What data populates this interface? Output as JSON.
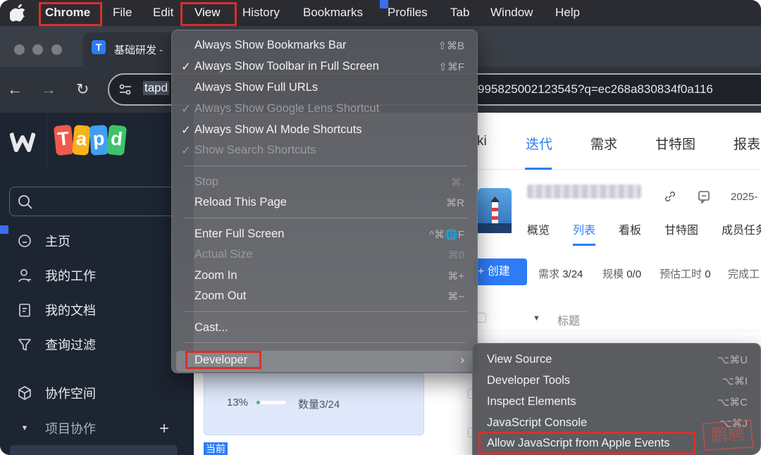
{
  "menubar": {
    "items": [
      "Chrome",
      "View",
      "Edit",
      "History",
      "Bookmarks",
      "Profiles",
      "Tab",
      "Window",
      "Help"
    ],
    "chrome": "Chrome",
    "file": "File",
    "edit": "Edit",
    "view": "View",
    "history": "History",
    "bookmarks": "Bookmarks",
    "profiles": "Profiles",
    "tab": "Tab",
    "window": "Window",
    "help": "Help"
  },
  "browser": {
    "tab_title": "基础研发 -",
    "url_selected": "tapd",
    "url_tail": "995825002123545?q=ec268a830834f0a116"
  },
  "sidebar": {
    "search_placeholder": "",
    "items": {
      "home": "主页",
      "my_work": "我的工作",
      "my_docs": "我的文档",
      "query_filter": "查询过滤",
      "collab_space": "协作空间",
      "project_collab": "项目协作"
    }
  },
  "main": {
    "topnav": {
      "wiki": "ki",
      "iteration": "迭代",
      "requirement": "需求",
      "gantt": "甘特图",
      "report": "报表"
    },
    "date": "2025-",
    "subnav": {
      "overview": "概览",
      "list": "列表",
      "board": "看板",
      "gantt": "甘特图",
      "members": "成员任务"
    },
    "create_button": "+ 创建",
    "stats": {
      "req_label": "需求",
      "req_value": "3/24",
      "scale_label": "规模",
      "scale_value": "0/0",
      "est_label": "预估工时",
      "est_value": "0",
      "done_label": "完成工"
    },
    "column_title": "标题",
    "card": {
      "percent": "13%",
      "progress": 0.13,
      "count": "数量3/24"
    },
    "current_tag": "当前"
  },
  "view_menu": {
    "items": [
      {
        "label": "Always Show Bookmarks Bar",
        "shortcut": "⇧⌘B",
        "checked": false,
        "disabled": false
      },
      {
        "label": "Always Show Toolbar in Full Screen",
        "shortcut": "⇧⌘F",
        "checked": true,
        "disabled": false
      },
      {
        "label": "Always Show Full URLs",
        "shortcut": "",
        "checked": false,
        "disabled": false
      },
      {
        "label": "Always Show Google Lens Shortcut",
        "shortcut": "",
        "checked": true,
        "disabled": true
      },
      {
        "label": "Always Show AI Mode Shortcuts",
        "shortcut": "",
        "checked": true,
        "disabled": false
      },
      {
        "label": "Show Search Shortcuts",
        "shortcut": "",
        "checked": true,
        "disabled": true
      },
      {
        "label": "Stop",
        "shortcut": "⌘.",
        "checked": false,
        "disabled": true
      },
      {
        "label": "Reload This Page",
        "shortcut": "⌘R",
        "checked": false,
        "disabled": false
      },
      {
        "label": "Enter Full Screen",
        "shortcut": "^⌘🌐F",
        "checked": false,
        "disabled": false
      },
      {
        "label": "Actual Size",
        "shortcut": "⌘0",
        "checked": false,
        "disabled": true
      },
      {
        "label": "Zoom In",
        "shortcut": "⌘+",
        "checked": false,
        "disabled": false
      },
      {
        "label": "Zoom Out",
        "shortcut": "⌘−",
        "checked": false,
        "disabled": false
      },
      {
        "label": "Cast...",
        "shortcut": "",
        "checked": false,
        "disabled": false
      },
      {
        "label": "Developer",
        "shortcut": "",
        "checked": false,
        "disabled": false
      }
    ],
    "checkmark": "✓",
    "submenu_arrow": "›"
  },
  "developer_menu": {
    "items": [
      {
        "label": "View Source",
        "shortcut": "⌥⌘U"
      },
      {
        "label": "Developer Tools",
        "shortcut": "⌥⌘I"
      },
      {
        "label": "Inspect Elements",
        "shortcut": "⌥⌘C"
      },
      {
        "label": "JavaScript Console",
        "shortcut": "⌥⌘J"
      },
      {
        "label": "Allow JavaScript from Apple Events",
        "shortcut": ""
      }
    ]
  },
  "watermark": "鹏騁"
}
